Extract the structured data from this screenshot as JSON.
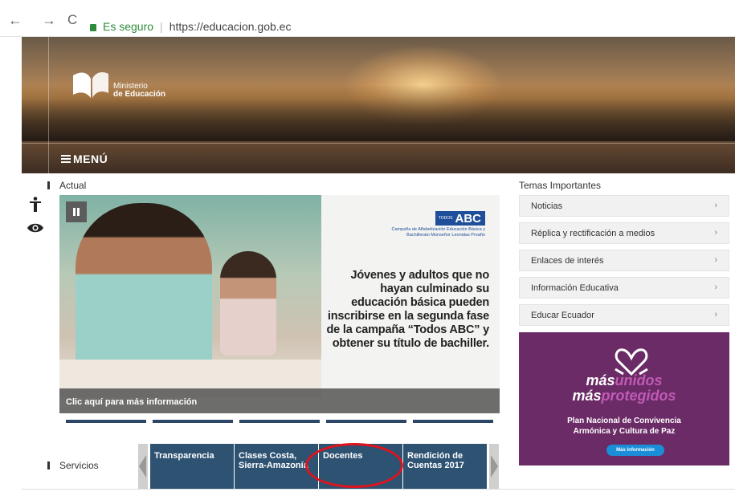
{
  "browser": {
    "back": "←",
    "forward": "→",
    "reload": "C",
    "secure_label": "Es seguro",
    "separator": "|",
    "url": "https://educacion.gob.ec"
  },
  "header": {
    "logo_line1": "Ministerio",
    "logo_line2": "de Educación",
    "menu_label": "MENÚ"
  },
  "sections": {
    "actual": "Actual",
    "temas": "Temas Importantes",
    "servicios": "Servicios"
  },
  "slide": {
    "badge_small": "TODOS",
    "badge": "ABC",
    "campaign_line1": "Campaña de Alfabetización Educación Básica y",
    "campaign_line2": "Bachillerato Monseñor Leonidas Proaño",
    "headline": "Jóvenes y adultos que no hayan culminado su educación básica pueden inscribirse en la segunda fase de la campaña “Todos ABC” y obtener su título de bachiller.",
    "caption": "Clic aquí para más información"
  },
  "topics": [
    {
      "label": "Noticias"
    },
    {
      "label": "Réplica y rectificación a medios"
    },
    {
      "label": "Enlaces de interés"
    },
    {
      "label": "Información Educativa"
    },
    {
      "label": "Educar Ecuador"
    }
  ],
  "chevron": "›",
  "promo": {
    "line1a": "más",
    "line1b": "unidos",
    "line2a": "más",
    "line2b": "protegidos",
    "line3": "Plan Nacional de Convivencia",
    "line4": "Armónica y Cultura de Paz",
    "button": "Más información"
  },
  "services": [
    {
      "label": "Transparencia"
    },
    {
      "label": "Clases Costa, Sierra-Amazonía"
    },
    {
      "label": "Docentes"
    },
    {
      "label": "Rendición de Cuentas 2017"
    }
  ],
  "colors": {
    "accent_blue": "#2d5272",
    "promo_purple": "#6b2b66",
    "highlight_red": "#e0131d",
    "secure_green": "#2e8b3a"
  }
}
